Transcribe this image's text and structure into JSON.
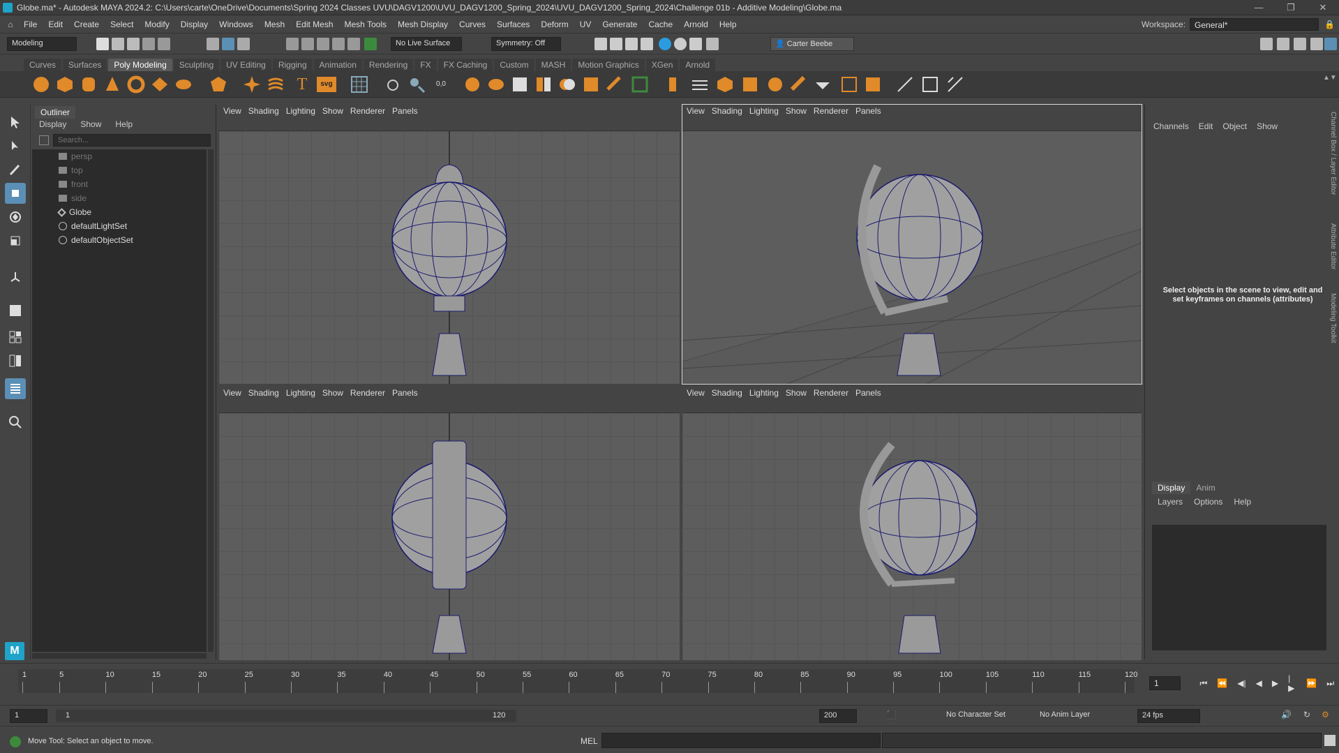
{
  "titlebar": {
    "title": "Globe.ma* - Autodesk MAYA 2024.2: C:\\Users\\carte\\OneDrive\\Documents\\Spring 2024 Classes UVU\\DAGV1200\\UVU_DAGV1200_Spring_2024\\UVU_DAGV1200_Spring_2024\\Challenge 01b - Additive Modeling\\Globe.ma",
    "minimize": "—",
    "maximize": "❐",
    "close": "✕"
  },
  "menubar": {
    "items": [
      "File",
      "Edit",
      "Create",
      "Select",
      "Modify",
      "Display",
      "Windows",
      "Mesh",
      "Edit Mesh",
      "Mesh Tools",
      "Mesh Display",
      "Curves",
      "Surfaces",
      "Deform",
      "UV",
      "Generate",
      "Cache",
      "Arnold",
      "Help"
    ],
    "workspace_label": "Workspace:",
    "workspace_value": "General*"
  },
  "statusline": {
    "mode": "Modeling",
    "live_surface": "No Live Surface",
    "symmetry": "Symmetry: Off",
    "user": "Carter Beebe"
  },
  "shelf": {
    "tabs": [
      "Curves",
      "Surfaces",
      "Poly Modeling",
      "Sculpting",
      "UV Editing",
      "Rigging",
      "Animation",
      "Rendering",
      "FX",
      "FX Caching",
      "Custom",
      "MASH",
      "Motion Graphics",
      "XGen",
      "Arnold"
    ],
    "active_tab": "Poly Modeling",
    "svg_label": "svg",
    "coords_label": "0,0"
  },
  "outliner": {
    "tab": "Outliner",
    "menu": [
      "Display",
      "Show",
      "Help"
    ],
    "search_placeholder": "Search...",
    "items": [
      {
        "label": "persp",
        "type": "camera",
        "dim": true
      },
      {
        "label": "top",
        "type": "camera",
        "dim": true
      },
      {
        "label": "front",
        "type": "camera",
        "dim": true
      },
      {
        "label": "side",
        "type": "camera",
        "dim": true
      },
      {
        "label": "Globe",
        "type": "group",
        "dim": false
      },
      {
        "label": "defaultLightSet",
        "type": "set",
        "dim": false
      },
      {
        "label": "defaultObjectSet",
        "type": "set",
        "dim": false
      }
    ]
  },
  "viewport": {
    "menu": [
      "View",
      "Shading",
      "Lighting",
      "Show",
      "Renderer",
      "Panels"
    ]
  },
  "channel_box": {
    "menu": [
      "Channels",
      "Edit",
      "Object",
      "Show"
    ],
    "info": "Select objects in the scene to view, edit and set keyframes on channels (attributes)",
    "layer_tabs": [
      "Display",
      "Anim"
    ],
    "layer_menu": [
      "Layers",
      "Options",
      "Help"
    ]
  },
  "side_tabs": [
    "Channel Box / Layer Editor",
    "Attribute Editor",
    "Modeling Toolkit"
  ],
  "timeline": {
    "ticks": [
      "1",
      "5",
      "10",
      "15",
      "20",
      "25",
      "30",
      "35",
      "40",
      "45",
      "50",
      "55",
      "60",
      "65",
      "70",
      "75",
      "80",
      "85",
      "90",
      "95",
      "100",
      "105",
      "110",
      "115",
      "120"
    ],
    "current_frame": "1"
  },
  "range": {
    "start": "1",
    "inner_start": "1",
    "inner_end": "120",
    "end": "200",
    "character_set": "No Character Set",
    "anim_layer": "No Anim Layer",
    "fps": "24 fps"
  },
  "cmdline": {
    "help": "Move Tool: Select an object to move.",
    "lang": "MEL"
  },
  "colors": {
    "accent": "#5b8fb5",
    "wire": "#1a1a6e",
    "shelf_orange": "#e08a2a"
  }
}
